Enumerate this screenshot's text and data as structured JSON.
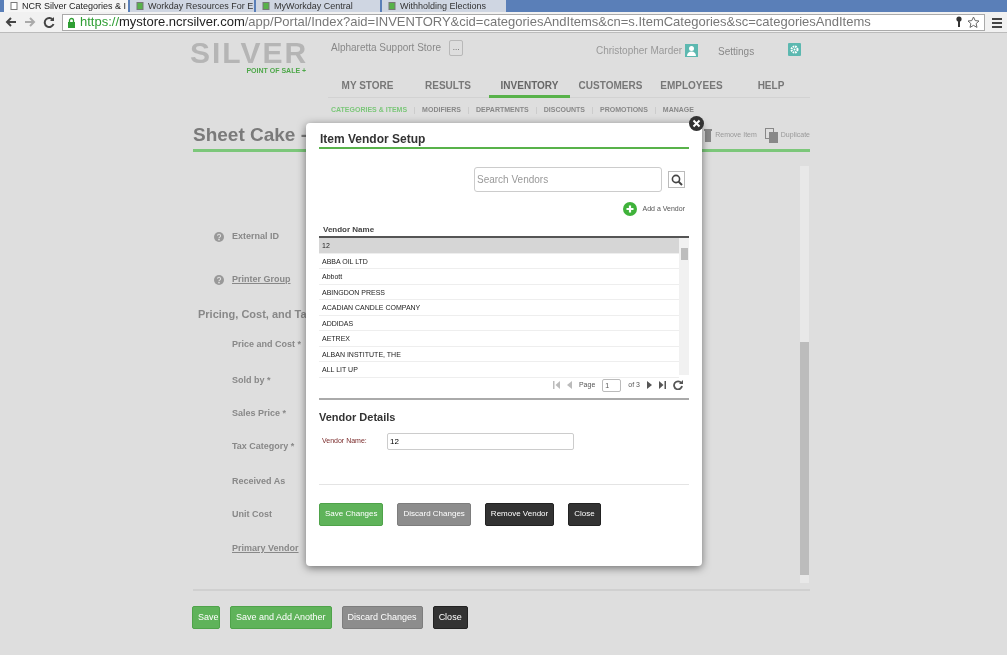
{
  "browser": {
    "tabs": [
      {
        "title": "NCR Silver Categories & I",
        "selected": true
      },
      {
        "title": "Workday Resources For E",
        "selected": false
      },
      {
        "title": "MyWorkday Central",
        "selected": false
      },
      {
        "title": "Withholding Elections",
        "selected": false
      }
    ],
    "url": {
      "scheme": "https://",
      "host": "mystore.ncrsilver.com",
      "path": "/app/Portal/Index?aid=INVENTORY&cid=categoriesAndItems&cn=s.ItemCategories&sc=categoriesAndItems"
    }
  },
  "header": {
    "logo": "SILVER",
    "logo_tagline": "POINT OF SALE +",
    "store": "Alpharetta Support Store",
    "store_menu": "...",
    "user": "Christopher Marder",
    "settings": "Settings"
  },
  "nav": [
    {
      "label": "MY STORE",
      "selected": false
    },
    {
      "label": "RESULTS",
      "selected": false
    },
    {
      "label": "INVENTORY",
      "selected": true
    },
    {
      "label": "CUSTOMERS",
      "selected": false
    },
    {
      "label": "EMPLOYEES",
      "selected": false
    },
    {
      "label": "HELP",
      "selected": false
    }
  ],
  "subnav": [
    {
      "label": "CATEGORIES & ITEMS",
      "selected": true
    },
    {
      "label": "MODIFIERS",
      "selected": false
    },
    {
      "label": "DEPARTMENTS",
      "selected": false
    },
    {
      "label": "DISCOUNTS",
      "selected": false
    },
    {
      "label": "PROMOTIONS",
      "selected": false
    },
    {
      "label": "MANAGE",
      "selected": false
    }
  ],
  "item": {
    "title": "Sheet Cake -",
    "actions": [
      "Remove Item",
      "Duplicate"
    ]
  },
  "form": {
    "fields": [
      {
        "label": "External ID",
        "kind": "help"
      },
      {
        "label": "Printer Group",
        "kind": "helplink"
      },
      {
        "label": "Pricing, Cost, and Ta",
        "kind": "section"
      },
      {
        "label": "Price and Cost *",
        "kind": "plain"
      },
      {
        "label": "Sold by *",
        "kind": "plain"
      },
      {
        "label": "Sales Price *",
        "kind": "plain"
      },
      {
        "label": "Tax Category *",
        "kind": "plain"
      },
      {
        "label": "Received As",
        "kind": "plain"
      },
      {
        "label": "Unit Cost",
        "kind": "plain"
      },
      {
        "label": "Primary Vendor",
        "kind": "link"
      }
    ]
  },
  "footer_buttons": [
    {
      "label": "Save",
      "kind": "green",
      "disabled": true
    },
    {
      "label": "Save and Add Another",
      "kind": "green",
      "disabled": true
    },
    {
      "label": "Discard Changes",
      "kind": "grey",
      "disabled": true
    },
    {
      "label": "Close",
      "kind": "dark",
      "disabled": false
    }
  ],
  "dialog": {
    "title": "Item Vendor Setup",
    "search": {
      "placeholder": "Search Vendors"
    },
    "add_link": "Add a Vendor",
    "column": "Vendor Name",
    "vendors": [
      {
        "name": "12",
        "selected": true
      },
      {
        "name": "ABBA OIL LTD",
        "selected": false
      },
      {
        "name": "Abbott",
        "selected": false
      },
      {
        "name": "ABINGDON PRESS",
        "selected": false
      },
      {
        "name": "ACADIAN CANDLE COMPANY",
        "selected": false
      },
      {
        "name": "ADDIDAS",
        "selected": false
      },
      {
        "name": "AETREX",
        "selected": false
      },
      {
        "name": "ALBAN INSTITUTE, THE",
        "selected": false
      },
      {
        "name": "ALL LIT UP",
        "selected": false
      }
    ],
    "pager": {
      "label": "Page",
      "page": "1",
      "of": "of 3"
    },
    "details_title": "Vendor Details",
    "vendor_label": "Vendor Name:",
    "vendor_value": "12",
    "buttons": [
      {
        "label": "Save Changes",
        "kind": "green",
        "disabled": true
      },
      {
        "label": "Discard Changes",
        "kind": "grey",
        "disabled": true
      },
      {
        "label": "Remove Vendor",
        "kind": "dark",
        "disabled": false
      },
      {
        "label": "Close",
        "kind": "dark",
        "disabled": false
      }
    ]
  }
}
